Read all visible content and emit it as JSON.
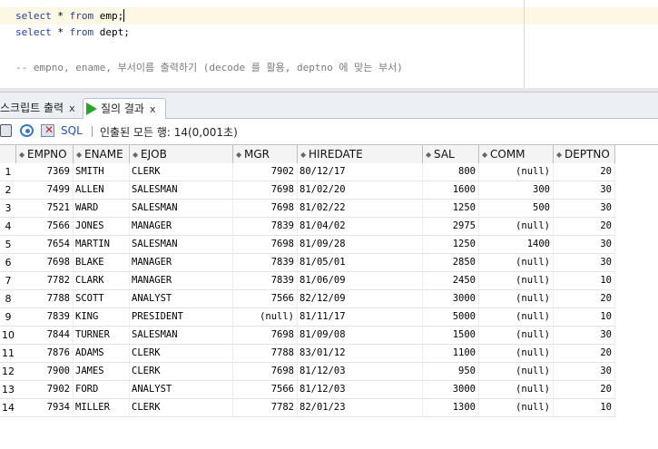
{
  "editor": {
    "line1": {
      "kw1": "select",
      "mid": " * ",
      "kw2": "from",
      "rest": " emp;"
    },
    "line2": {
      "kw1": "select",
      "mid": " * ",
      "kw2": "from",
      "rest": " dept;"
    },
    "comment": "-- empno, ename, 부서이름 출력하기 (decode 를 활용, deptno 에 맞는 부서)"
  },
  "tabs": {
    "script_output": "스크립트 출력",
    "query_result": "질의 결과",
    "close": "x"
  },
  "toolbar": {
    "sql": "SQL",
    "status": "인출된 모든 행: 14(0,001초)"
  },
  "grid": {
    "columns": [
      "EMPNO",
      "ENAME",
      "EJOB",
      "MGR",
      "HIREDATE",
      "SAL",
      "COMM",
      "DEPTNO"
    ],
    "rows": [
      {
        "n": "1",
        "empno": "7369",
        "ename": "SMITH",
        "ejob": "CLERK",
        "mgr": "7902",
        "hiredate": "80/12/17",
        "sal": "800",
        "comm": "(null)",
        "deptno": "20"
      },
      {
        "n": "2",
        "empno": "7499",
        "ename": "ALLEN",
        "ejob": "SALESMAN",
        "mgr": "7698",
        "hiredate": "81/02/20",
        "sal": "1600",
        "comm": "300",
        "deptno": "30"
      },
      {
        "n": "3",
        "empno": "7521",
        "ename": "WARD",
        "ejob": "SALESMAN",
        "mgr": "7698",
        "hiredate": "81/02/22",
        "sal": "1250",
        "comm": "500",
        "deptno": "30"
      },
      {
        "n": "4",
        "empno": "7566",
        "ename": "JONES",
        "ejob": "MANAGER",
        "mgr": "7839",
        "hiredate": "81/04/02",
        "sal": "2975",
        "comm": "(null)",
        "deptno": "20"
      },
      {
        "n": "5",
        "empno": "7654",
        "ename": "MARTIN",
        "ejob": "SALESMAN",
        "mgr": "7698",
        "hiredate": "81/09/28",
        "sal": "1250",
        "comm": "1400",
        "deptno": "30"
      },
      {
        "n": "6",
        "empno": "7698",
        "ename": "BLAKE",
        "ejob": "MANAGER",
        "mgr": "7839",
        "hiredate": "81/05/01",
        "sal": "2850",
        "comm": "(null)",
        "deptno": "30"
      },
      {
        "n": "7",
        "empno": "7782",
        "ename": "CLARK",
        "ejob": "MANAGER",
        "mgr": "7839",
        "hiredate": "81/06/09",
        "sal": "2450",
        "comm": "(null)",
        "deptno": "10"
      },
      {
        "n": "8",
        "empno": "7788",
        "ename": "SCOTT",
        "ejob": "ANALYST",
        "mgr": "7566",
        "hiredate": "82/12/09",
        "sal": "3000",
        "comm": "(null)",
        "deptno": "20"
      },
      {
        "n": "9",
        "empno": "7839",
        "ename": "KING",
        "ejob": "PRESIDENT",
        "mgr": "(null)",
        "hiredate": "81/11/17",
        "sal": "5000",
        "comm": "(null)",
        "deptno": "10"
      },
      {
        "n": "10",
        "empno": "7844",
        "ename": "TURNER",
        "ejob": "SALESMAN",
        "mgr": "7698",
        "hiredate": "81/09/08",
        "sal": "1500",
        "comm": "(null)",
        "deptno": "30"
      },
      {
        "n": "11",
        "empno": "7876",
        "ename": "ADAMS",
        "ejob": "CLERK",
        "mgr": "7788",
        "hiredate": "83/01/12",
        "sal": "1100",
        "comm": "(null)",
        "deptno": "20"
      },
      {
        "n": "12",
        "empno": "7900",
        "ename": "JAMES",
        "ejob": "CLERK",
        "mgr": "7698",
        "hiredate": "81/12/03",
        "sal": "950",
        "comm": "(null)",
        "deptno": "30"
      },
      {
        "n": "13",
        "empno": "7902",
        "ename": "FORD",
        "ejob": "ANALYST",
        "mgr": "7566",
        "hiredate": "81/12/03",
        "sal": "3000",
        "comm": "(null)",
        "deptno": "20"
      },
      {
        "n": "14",
        "empno": "7934",
        "ename": "MILLER",
        "ejob": "CLERK",
        "mgr": "7782",
        "hiredate": "82/01/23",
        "sal": "1300",
        "comm": "(null)",
        "deptno": "10"
      }
    ]
  }
}
